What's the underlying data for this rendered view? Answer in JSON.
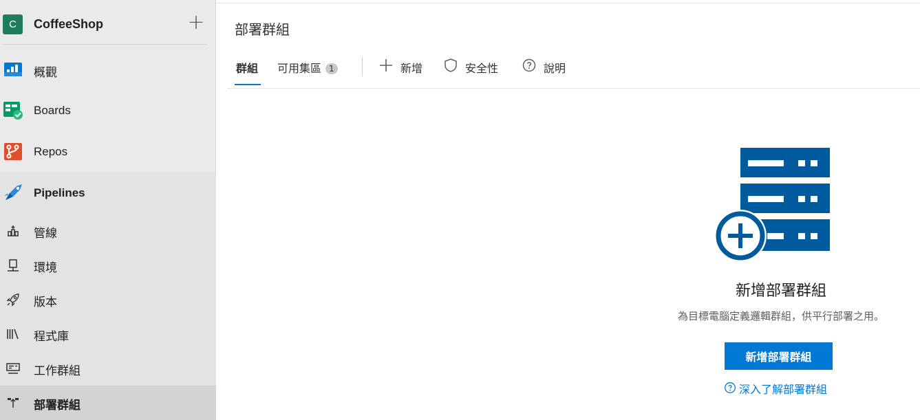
{
  "project": {
    "avatar_letter": "C",
    "name": "CoffeeShop",
    "add_symbol": "+"
  },
  "nav": {
    "items": [
      {
        "label": "概觀",
        "icon": "overview-icon"
      },
      {
        "label": "Boards",
        "icon": "boards-icon"
      },
      {
        "label": "Repos",
        "icon": "repos-icon"
      },
      {
        "label": "Pipelines",
        "icon": "pipelines-icon"
      }
    ],
    "pipelines_sub": [
      {
        "label": "管線",
        "icon": "pipeline-icon"
      },
      {
        "label": "環境",
        "icon": "environment-icon"
      },
      {
        "label": "版本",
        "icon": "rocket-icon"
      },
      {
        "label": "程式庫",
        "icon": "library-icon"
      },
      {
        "label": "工作群組",
        "icon": "task-group-icon"
      },
      {
        "label": "部署群組",
        "icon": "deployment-group-icon"
      }
    ]
  },
  "page": {
    "title": "部署群組"
  },
  "tabs": [
    {
      "label": "群組",
      "active": true
    },
    {
      "label": "可用集區",
      "badge": "1"
    }
  ],
  "commands": {
    "new": "新增",
    "security": "安全性",
    "help": "說明"
  },
  "empty_state": {
    "title": "新增部署群組",
    "description": "為目標電腦定義邏輯群組，供平行部署之用。",
    "button": "新增部署群組",
    "learn_more": "深入了解部署群組"
  },
  "colors": {
    "accent": "#0078d4",
    "illustration": "#005a9e",
    "avatar": "#1e7d5d"
  }
}
